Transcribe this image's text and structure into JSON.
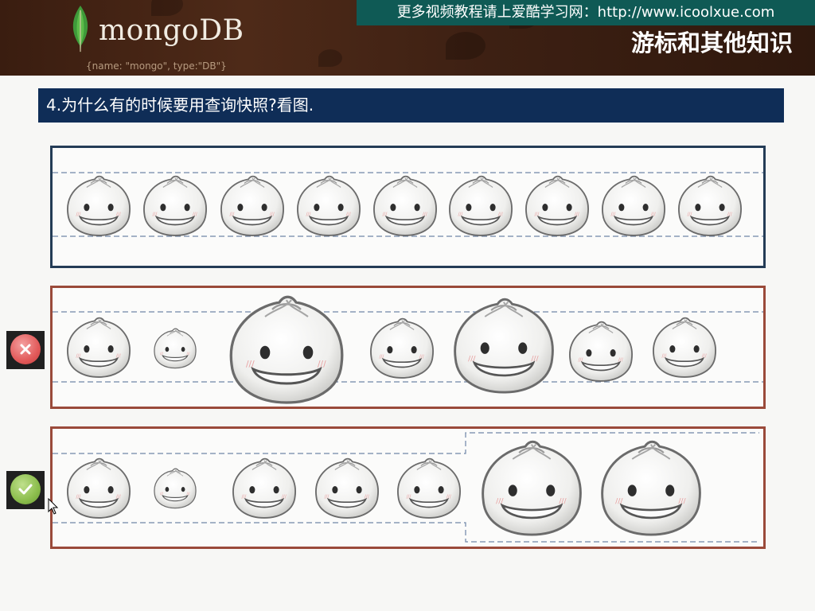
{
  "header": {
    "logo_text": "mongoDB",
    "logo_subtext": "{name: \"mongo\", type:\"DB\"}",
    "watermark": "更多视频教程请上爱酷学习网：http://www.icoolxue.com",
    "slide_title": "游标和其他知识"
  },
  "question": {
    "text": "4.为什么有的时候要用查询快照?看图."
  },
  "icons": {
    "leaf": "mongodb-leaf-icon",
    "bad": "red-x-icon",
    "good": "green-check-icon",
    "cursor": "mouse-cursor-icon",
    "bun": "bun-face-icon"
  },
  "colors": {
    "heading_bg": "#0f2d57",
    "watermark_bg": "#0f5a55",
    "panel_top_border": "#243c56",
    "panel_other_border": "#9a4a3a",
    "bad": "#e25a5a",
    "good": "#8bbd4c"
  }
}
